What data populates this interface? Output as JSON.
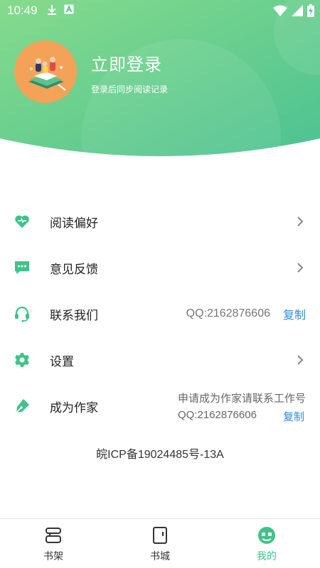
{
  "status_bar": {
    "time": "10:49",
    "icons_left": [
      "download-icon",
      "a-notification-icon"
    ],
    "icons_right": [
      "wifi-icon",
      "signal-icon",
      "battery-charging-icon"
    ]
  },
  "colors": {
    "header_gradient_start": "#7dd88e",
    "header_gradient_end": "#4fc390",
    "accent_green": "#3fc38a",
    "link_blue": "#2f8ae4",
    "avatar_bg": "#f4a258"
  },
  "profile": {
    "login_title": "立即登录",
    "login_subtitle": "登录后同步阅读记录"
  },
  "menu": {
    "reading_pref": {
      "label": "阅读偏好",
      "icon": "heart-icon"
    },
    "feedback": {
      "label": "意见反馈",
      "icon": "chat-bubble-icon"
    },
    "contact": {
      "label": "联系我们",
      "icon": "headset-icon",
      "qq": "QQ:2162876606",
      "copy": "复制"
    },
    "settings": {
      "label": "设置",
      "icon": "gear-icon"
    },
    "author": {
      "label": "成为作家",
      "icon": "pen-icon",
      "hint": "申请成为作家请联系工作号",
      "qq": "QQ:2162876606",
      "copy": "复制"
    }
  },
  "icp": "皖ICP备19024485号-13A",
  "bottom_nav": [
    {
      "label": "书架",
      "icon": "bookshelf-icon",
      "active": false
    },
    {
      "label": "书城",
      "icon": "book-store-icon",
      "active": false
    },
    {
      "label": "我的",
      "icon": "profile-icon",
      "active": true
    }
  ]
}
